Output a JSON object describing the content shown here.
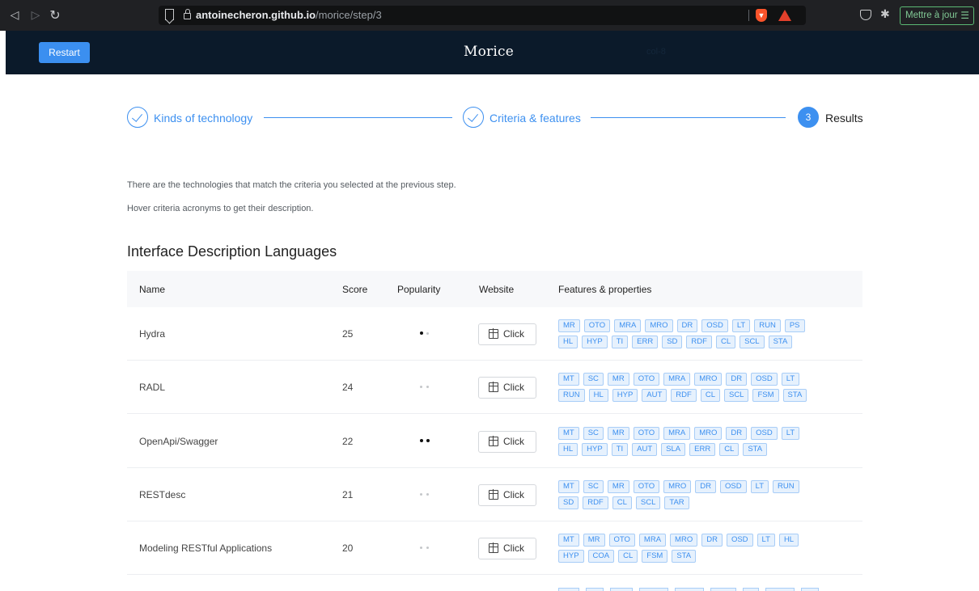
{
  "browser": {
    "url_host": "antoinecheron.github.io",
    "url_path": "/morice/step/3",
    "update_button": "Mettre à jour"
  },
  "header": {
    "restart_label": "Restart",
    "title": "Morice",
    "ghost_text": "col-8"
  },
  "steps": [
    {
      "label": "Kinds of technology",
      "status": "done"
    },
    {
      "label": "Criteria & features",
      "status": "done"
    },
    {
      "label": "Results",
      "number": "3",
      "status": "active"
    }
  ],
  "intro": {
    "line1": "There are the technologies that match the criteria you selected at the previous step.",
    "line2": "Hover criteria acronyms to get their description."
  },
  "section": {
    "title": "Interface Description Languages"
  },
  "table": {
    "headers": {
      "name": "Name",
      "score": "Score",
      "popularity": "Popularity",
      "website": "Website",
      "features": "Features & properties"
    },
    "click_label": "Click",
    "rows": [
      {
        "name": "Hydra",
        "score": "25",
        "popularity": 1,
        "tags": [
          [
            "MR",
            "OTO",
            "MRA",
            "MRO",
            "DR",
            "OSD",
            "LT",
            "RUN",
            "PS"
          ],
          [
            "HL",
            "HYP",
            "TI",
            "ERR",
            "SD",
            "RDF",
            "CL",
            "SCL",
            "STA"
          ]
        ]
      },
      {
        "name": "RADL",
        "score": "24",
        "popularity": 0,
        "tags": [
          [
            "MT",
            "SC",
            "MR",
            "OTO",
            "MRA",
            "MRO",
            "DR",
            "OSD",
            "LT"
          ],
          [
            "RUN",
            "HL",
            "HYP",
            "AUT",
            "RDF",
            "CL",
            "SCL",
            "FSM",
            "STA"
          ]
        ]
      },
      {
        "name": "OpenApi/Swagger",
        "score": "22",
        "popularity": 2,
        "tags": [
          [
            "MT",
            "SC",
            "MR",
            "OTO",
            "MRA",
            "MRO",
            "DR",
            "OSD",
            "LT"
          ],
          [
            "HL",
            "HYP",
            "TI",
            "AUT",
            "SLA",
            "ERR",
            "CL",
            "STA"
          ]
        ]
      },
      {
        "name": "RESTdesc",
        "score": "21",
        "popularity": 0,
        "tags": [
          [
            "MT",
            "SC",
            "MR",
            "OTO",
            "MRO",
            "DR",
            "OSD",
            "LT",
            "RUN"
          ],
          [
            "SD",
            "RDF",
            "CL",
            "SCL",
            "TAR"
          ]
        ]
      },
      {
        "name": "Modeling RESTful Applications",
        "score": "20",
        "popularity": 0,
        "tags": [
          [
            "MT",
            "MR",
            "OTO",
            "MRA",
            "MRO",
            "DR",
            "OSD",
            "LT",
            "HL"
          ],
          [
            "HYP",
            "COA",
            "CL",
            "FSM",
            "STA"
          ]
        ]
      }
    ]
  },
  "colors": {
    "accent": "#3d90f0",
    "header_bg": "#0b1a2a",
    "tag_bg": "#e6f1fd"
  }
}
